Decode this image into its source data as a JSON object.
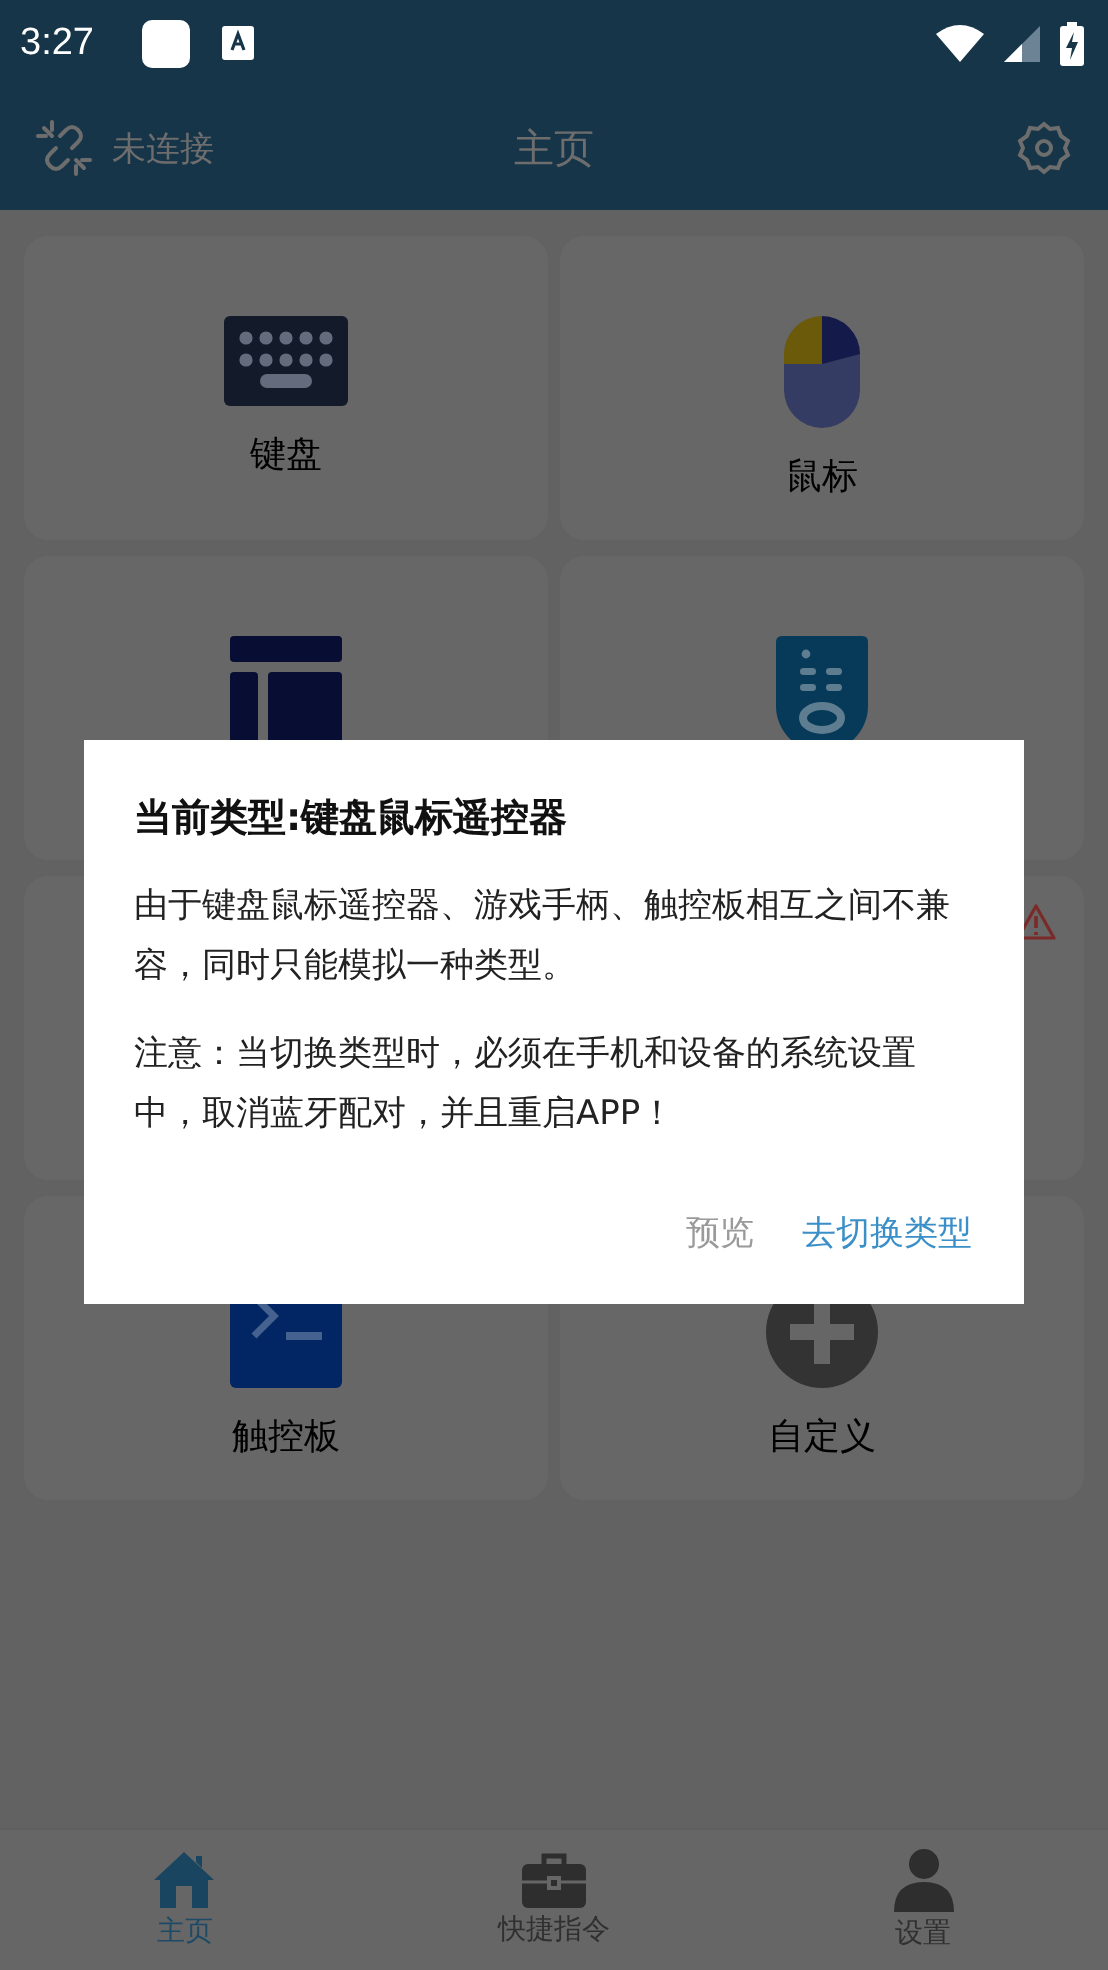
{
  "status_bar": {
    "time": "3:27"
  },
  "app_bar": {
    "connection": "未连接",
    "title": "主页"
  },
  "cards": [
    {
      "kind": "keyboard",
      "label": "键盘"
    },
    {
      "kind": "mouse",
      "label": "鼠标"
    },
    {
      "kind": "layout"
    },
    {
      "kind": "remote"
    },
    {
      "kind": "blank"
    },
    {
      "kind": "warning"
    },
    {
      "kind": "touchpad",
      "label": "触控板"
    },
    {
      "kind": "plus",
      "label": "自定义"
    }
  ],
  "dialog": {
    "title": "当前类型:键盘鼠标遥控器",
    "paragraphs": [
      "由于键盘鼠标遥控器、游戏手柄、触控板相互之间不兼容，同时只能模拟一种类型。",
      "注意：当切换类型时，必须在手机和设备的系统设置中，取消蓝牙配对，并且重启APP！"
    ],
    "buttons": [
      {
        "label": "预览",
        "kind": "secondary"
      },
      {
        "label": "去切换类型",
        "kind": "primary"
      }
    ]
  },
  "bottom_nav": [
    {
      "kind": "home",
      "label": "主页",
      "selected": true
    },
    {
      "kind": "briefcase",
      "label": "快捷指令",
      "selected": false
    },
    {
      "kind": "person",
      "label": "设置",
      "selected": false
    }
  ]
}
